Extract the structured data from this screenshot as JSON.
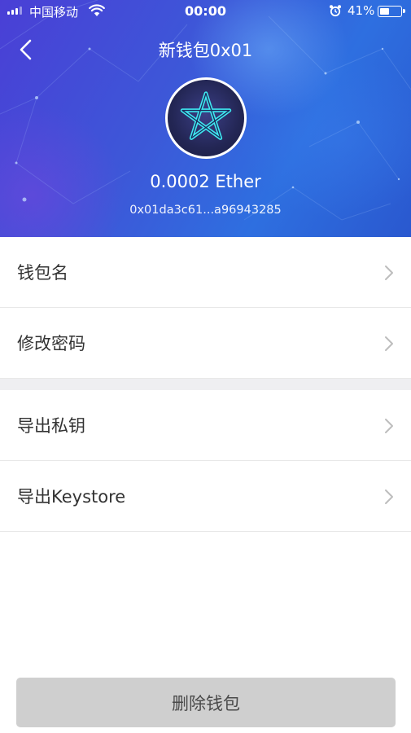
{
  "status_bar": {
    "carrier": "中国移动",
    "time": "00:00",
    "battery_percent": "41%",
    "battery_level": 0.41
  },
  "header": {
    "title": "新钱包0x01",
    "balance": "0.0002 Ether",
    "address": "0x01da3c61...a96943285"
  },
  "menu": {
    "group1": [
      {
        "label": "钱包名"
      },
      {
        "label": "修改密码"
      }
    ],
    "group2": [
      {
        "label": "导出私钥"
      },
      {
        "label": "导出Keystore"
      }
    ]
  },
  "actions": {
    "delete_label": "删除钱包"
  },
  "colors": {
    "header_start": "#4a3fd6",
    "header_end": "#2a58cf",
    "avatar_star": "#3ee8f0",
    "button_bg": "#cfcfcf",
    "separator": "#efeff1"
  },
  "icons": {
    "back": "chevron-left-icon",
    "row_arrow": "chevron-right-icon",
    "avatar": "pentagram-star-icon"
  }
}
